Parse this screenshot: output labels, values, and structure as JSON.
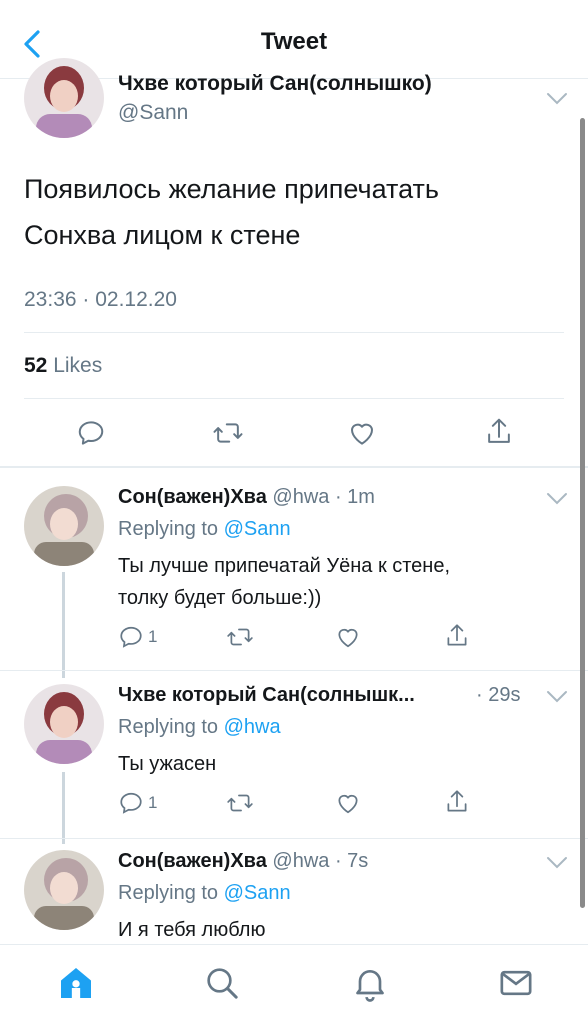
{
  "header": {
    "title": "Tweet"
  },
  "main_tweet": {
    "author_name": "Чхве который Сан(солнышко)",
    "author_handle": "@Sann",
    "text_line1": "Появилось желание припечатать",
    "text_line2": "Сонхва лицом к стене",
    "timestamp": "23:36 · 02.12.20",
    "likes_count": "52",
    "likes_label": "Likes"
  },
  "replies": [
    {
      "name": "Сон(важен)Хва",
      "handle": "@hwa",
      "time": "· 1m",
      "replying_prefix": "Replying to ",
      "replying_to": "@Sann",
      "text_line1": "Ты лучше припечатай Уёна к стене,",
      "text_line2": "толку будет больше:))",
      "reply_count": "1"
    },
    {
      "name": "Чхве который Сан(солнышк...",
      "handle": "",
      "time": "· 29s",
      "replying_prefix": "Replying to ",
      "replying_to": "@hwa",
      "text_line1": "Ты ужасен",
      "text_line2": "",
      "reply_count": "1"
    },
    {
      "name": "Сон(важен)Хва",
      "handle": "@hwa",
      "time": "· 7s",
      "replying_prefix": "Replying to ",
      "replying_to": "@Sann",
      "text_line1": "И я тебя люблю",
      "text_line2": "",
      "reply_count": ""
    }
  ],
  "icons": {
    "back": "chevron-left-icon",
    "reply": "comment-icon",
    "retweet": "retweet-icon",
    "like": "heart-icon",
    "share": "share-icon",
    "home": "home-icon",
    "search": "search-icon",
    "notifications": "bell-icon",
    "messages": "mail-icon"
  },
  "colors": {
    "accent": "#1da1f2",
    "muted": "#657786",
    "text": "#14171a",
    "divider": "#e6ecf0"
  }
}
